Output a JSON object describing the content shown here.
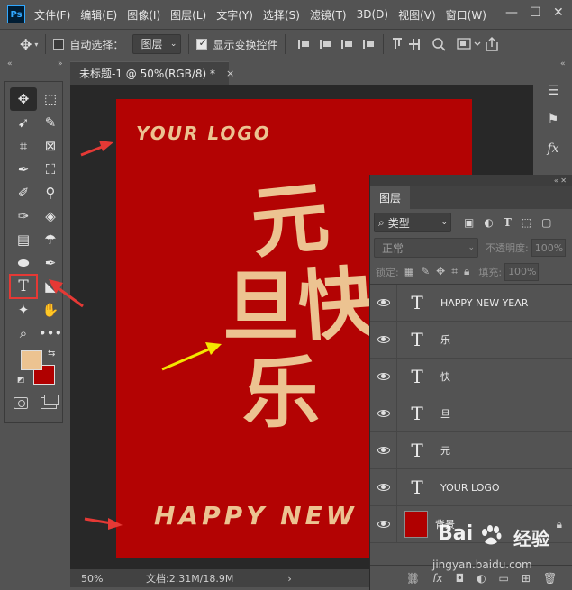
{
  "app": {
    "logo": "Ps",
    "menu": [
      "文件(F)",
      "编辑(E)",
      "图像(I)",
      "图层(L)",
      "文字(Y)",
      "选择(S)",
      "滤镜(T)",
      "3D(D)",
      "视图(V)",
      "窗口(W)"
    ],
    "window_controls": {
      "minimize": "—",
      "maximize": "☐",
      "close": "✕"
    }
  },
  "options_bar": {
    "auto_select_label": "自动选择：",
    "auto_select_checked": false,
    "target_value": "图层",
    "show_transform_label": "显示变换控件",
    "show_transform_checked": true
  },
  "document": {
    "tab_title": "未标题-1 @ 50%(RGB/8) *",
    "close": "×",
    "canvas": {
      "logo_text": "YOUR LOGO",
      "chars": [
        "元",
        "旦",
        "快",
        "乐"
      ],
      "footer_text": "HAPPY NEW YEAR",
      "bg_color": "#b30303",
      "text_color": "#ecc391"
    }
  },
  "status": {
    "zoom": "50%",
    "doc_info": "文档:2.31M/18.9M",
    "caret": "›"
  },
  "colors": {
    "foreground": "#ecc391",
    "background": "#b00000",
    "highlight": "#e53935",
    "arrow_red": "#e53935",
    "arrow_yellow": "#f4e600"
  },
  "layers_panel": {
    "tab": "图层",
    "filter_kind": "类型",
    "blend_mode": "正常",
    "opacity_label": "不透明度:",
    "opacity_value": "100%",
    "lock_label": "锁定:",
    "fill_label": "填充:",
    "fill_value": "100%",
    "layers": [
      {
        "type": "text",
        "name": "HAPPY NEW YEAR"
      },
      {
        "type": "text",
        "name": "乐"
      },
      {
        "type": "text",
        "name": "快"
      },
      {
        "type": "text",
        "name": "旦"
      },
      {
        "type": "text",
        "name": "元"
      },
      {
        "type": "text",
        "name": "YOUR LOGO"
      },
      {
        "type": "image",
        "name": "背景",
        "locked": true
      }
    ]
  },
  "watermark": {
    "brand": "Bai",
    "brand2": "经验",
    "url": "jingyan.baidu.com"
  }
}
